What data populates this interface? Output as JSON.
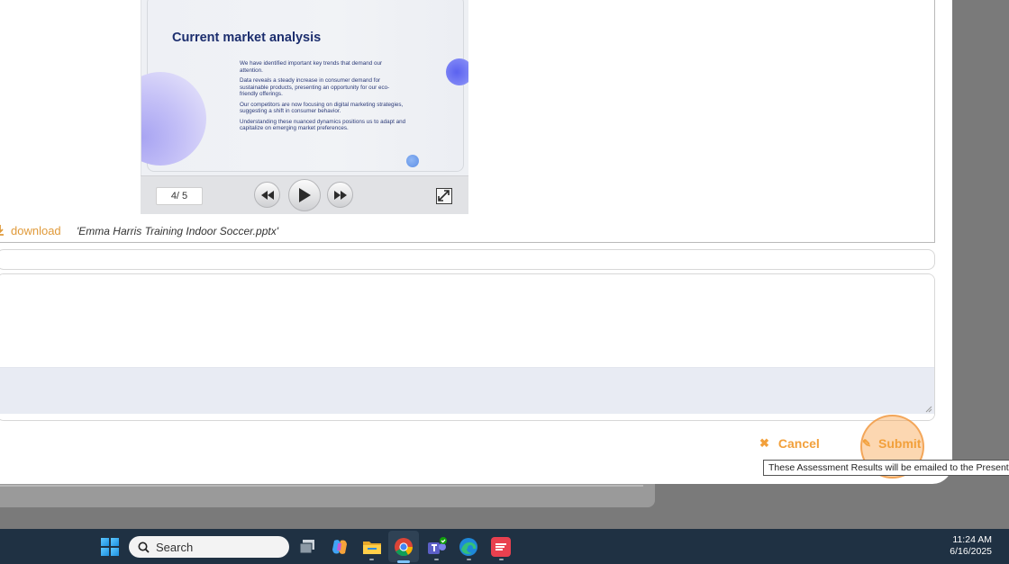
{
  "slide": {
    "title": "Current market analysis",
    "paragraphs": [
      "We have identified important key trends that demand our attention.",
      "Data reveals a steady increase in consumer demand for sustainable products, presenting an opportunity for our eco-friendly offerings.",
      "Our competitors are now focusing on digital marketing strategies, suggesting a shift in consumer behavior.",
      "Understanding these nuanced dynamics positions us to adapt and capitalize on emerging market preferences."
    ]
  },
  "player": {
    "page_indicator": "4/ 5",
    "current_page": 4,
    "total_pages": 5
  },
  "attachment": {
    "download_label": "download",
    "filename": "'Emma Harris Training Indoor Soccer.pptx'"
  },
  "form": {
    "input_value": "",
    "textarea_value": ""
  },
  "actions": {
    "cancel_label": "Cancel",
    "submit_label": "Submit",
    "submit_tooltip": "These Assessment Results will be emailed to the Presenter(s)"
  },
  "taskbar": {
    "search_placeholder": "Search",
    "time": "11:24 AM",
    "date": "6/16/2025",
    "apps": [
      "task-view-icon",
      "copilot-icon",
      "file-explorer-icon",
      "chrome-icon",
      "teams-icon",
      "edge-icon",
      "app-icon"
    ]
  },
  "colors": {
    "accent": "#f2a03b",
    "slide_title": "#1c2e6e",
    "taskbar": "#1f3143"
  }
}
